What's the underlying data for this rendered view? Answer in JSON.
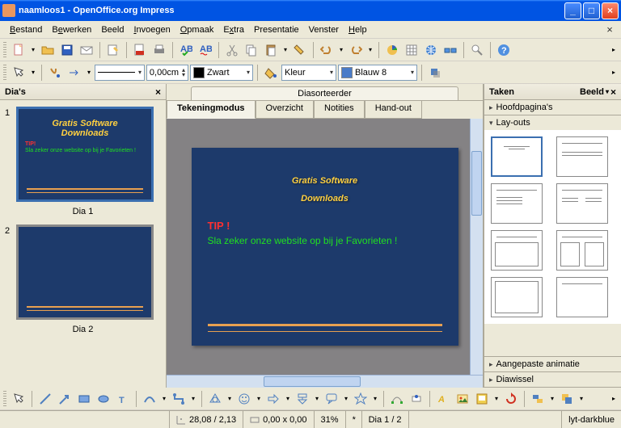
{
  "window": {
    "title": "naamloos1 - OpenOffice.org Impress"
  },
  "menu": {
    "bestand": "Bestand",
    "bewerken": "Bewerken",
    "beeld": "Beeld",
    "invoegen": "Invoegen",
    "opmaak": "Opmaak",
    "extra": "Extra",
    "presentatie": "Presentatie",
    "venster": "Venster",
    "help": "Help"
  },
  "tb2": {
    "linewidth": "0,00cm",
    "colorname": "Zwart",
    "fillmode": "Kleur",
    "fillcolor": "Blauw 8"
  },
  "slidepanel": {
    "title": "Dia's",
    "slides": [
      {
        "num": "1",
        "label": "Dia 1",
        "title1": "Gratis Software",
        "title2": "Downloads",
        "tip": "TIP!",
        "body": "Sla zeker onze website op bij je Favorieten !"
      },
      {
        "num": "2",
        "label": "Dia 2"
      }
    ]
  },
  "tabs": {
    "top": "Diasorteerder",
    "modes": {
      "tekening": "Tekeningmodus",
      "overzicht": "Overzicht",
      "notities": "Notities",
      "handout": "Hand-out"
    }
  },
  "slide": {
    "title1": "Gratis Software",
    "title2": "Downloads",
    "tip": "TIP !",
    "body": "Sla zeker onze website op bij je Favorieten !"
  },
  "tasks": {
    "title": "Taken",
    "view": "Beeld",
    "hoofd": "Hoofdpagina's",
    "layouts_hdr": "Lay-outs",
    "anim": "Aangepaste animatie",
    "diawissel": "Diawissel"
  },
  "status": {
    "coords": "28,08 / 2,13",
    "size": "0,00 x 0,00",
    "zoom": "31%",
    "slide": "Dia 1 / 2",
    "template": "lyt-darkblue"
  }
}
